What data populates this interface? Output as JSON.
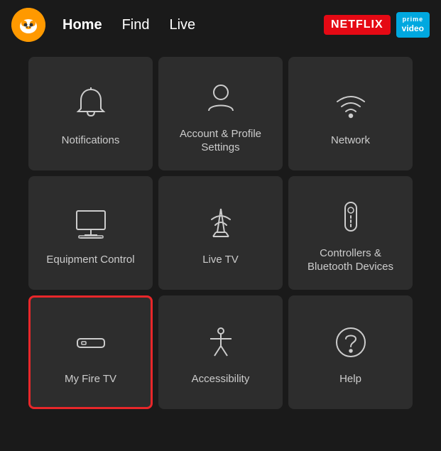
{
  "header": {
    "nav_items": [
      {
        "label": "Home",
        "active": true
      },
      {
        "label": "Find",
        "active": false
      },
      {
        "label": "Live",
        "active": false
      }
    ],
    "netflix_label": "NETFLIX",
    "prime_label_top": "prime",
    "prime_label_bottom": "video"
  },
  "grid": {
    "items": [
      {
        "id": "notifications",
        "label": "Notifications",
        "icon": "bell",
        "selected": false
      },
      {
        "id": "account-profile",
        "label": "Account & Profile Settings",
        "icon": "person",
        "selected": false
      },
      {
        "id": "network",
        "label": "Network",
        "icon": "wifi",
        "selected": false
      },
      {
        "id": "equipment-control",
        "label": "Equipment Control",
        "icon": "monitor",
        "selected": false
      },
      {
        "id": "live-tv",
        "label": "Live TV",
        "icon": "antenna",
        "selected": false
      },
      {
        "id": "controllers-bluetooth",
        "label": "Controllers & Bluetooth Devices",
        "icon": "remote",
        "selected": false
      },
      {
        "id": "my-fire-tv",
        "label": "My Fire TV",
        "icon": "firestick",
        "selected": true
      },
      {
        "id": "accessibility",
        "label": "Accessibility",
        "icon": "accessibility",
        "selected": false
      },
      {
        "id": "help",
        "label": "Help",
        "icon": "question",
        "selected": false
      }
    ]
  }
}
